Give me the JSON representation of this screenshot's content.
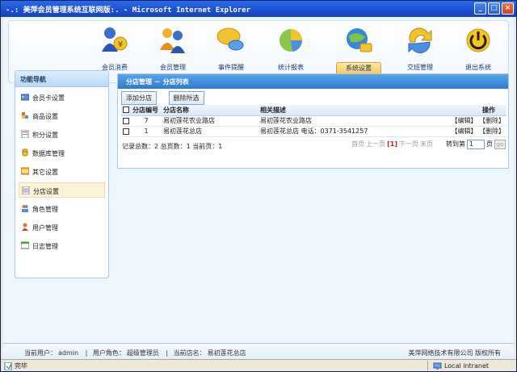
{
  "window": {
    "title": "-.: 美萍会员管理系统互联网版:. - Microsoft Internet Explorer",
    "minimize": "_",
    "maximize": "□",
    "close": "×"
  },
  "nav": {
    "items": [
      {
        "label": "会员消费",
        "icon": "member-consume-icon"
      },
      {
        "label": "会员管理",
        "icon": "member-manage-icon"
      },
      {
        "label": "事件提醒",
        "icon": "event-reminder-icon"
      },
      {
        "label": "统计报表",
        "icon": "statistics-report-icon"
      },
      {
        "label": "系统设置",
        "icon": "system-settings-icon"
      },
      {
        "label": "交班管理",
        "icon": "shift-handover-icon"
      },
      {
        "label": "退出系统",
        "icon": "exit-system-icon"
      }
    ],
    "active_index": 4
  },
  "sidebar": {
    "title": "功能导航",
    "items": [
      {
        "label": "会员卡设置",
        "icon": "card-icon"
      },
      {
        "label": "商品设置",
        "icon": "goods-icon"
      },
      {
        "label": "积分设置",
        "icon": "points-icon"
      },
      {
        "label": "数据库管理",
        "icon": "database-icon"
      },
      {
        "label": "其它设置",
        "icon": "other-settings-icon"
      },
      {
        "label": "分店设置",
        "icon": "branch-icon"
      },
      {
        "label": "角色管理",
        "icon": "role-icon"
      },
      {
        "label": "用户管理",
        "icon": "user-icon"
      },
      {
        "label": "日志管理",
        "icon": "log-icon"
      }
    ],
    "active_index": 5
  },
  "main": {
    "title": "分店管理 － 分店列表",
    "add_button": "添加分店",
    "delete_selected_button": "删除所选",
    "table": {
      "headers": [
        "分店编号",
        "分店名称",
        "相关描述",
        "操作"
      ],
      "rows": [
        {
          "id": "7",
          "name": "易初莲花农业路店",
          "desc": "易初莲花农业路店",
          "edit": "【编辑】",
          "del": "【删除】"
        },
        {
          "id": "1",
          "name": "易初莲花总店",
          "desc": "易初莲花总店  电话：0371-3541257",
          "edit": "【编辑】",
          "del": "【删除】"
        }
      ]
    },
    "pager": {
      "total_records_label": "记录总数：",
      "total_records": "2",
      "total_pages_label": "总页数：",
      "total_pages": "1",
      "current_page_label": "当前页：",
      "current_page": "1",
      "first": "首页",
      "prev": "上一页",
      "current": "[1]",
      "next": "下一页",
      "last": "末页",
      "goto_label": "转到第",
      "goto_value": "1",
      "page_unit": "页",
      "go": "go"
    }
  },
  "footer": {
    "current_user_label": "当前用户：",
    "current_user": "admin",
    "role_label": "用户角色：",
    "role": "超级管理员",
    "branch_label": "当前店名：",
    "branch": "易初莲花总店",
    "separator": "|",
    "copyright": "美萍网络技术有限公司 版权所有"
  },
  "statusbar": {
    "left": "完毕",
    "zone": "Local intranet"
  }
}
